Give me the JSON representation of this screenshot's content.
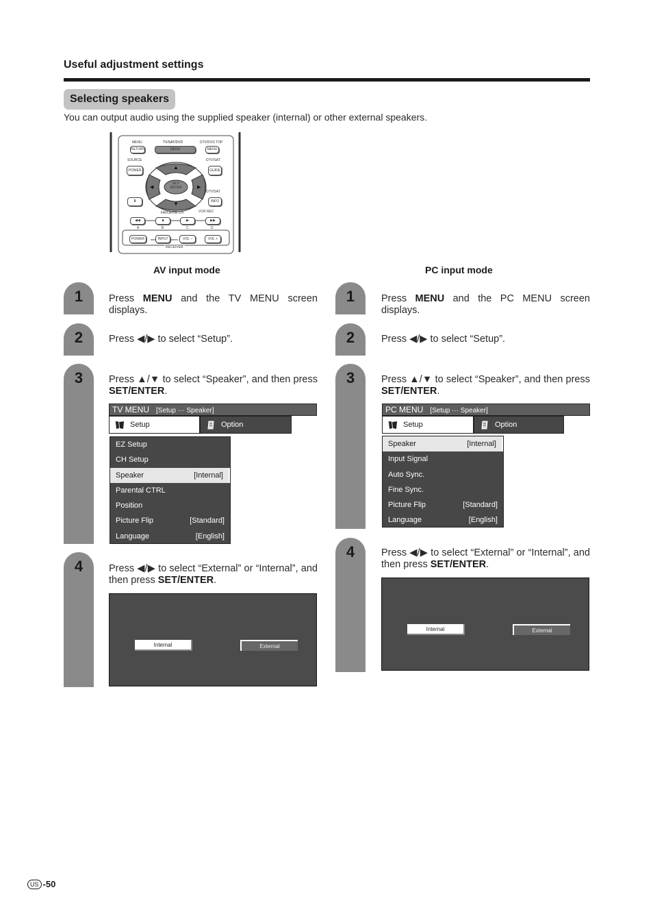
{
  "page": {
    "section_title": "Useful adjustment settings",
    "heading": "Selecting speakers",
    "intro": "You can output audio using the supplied speaker (internal) or other external speakers.",
    "page_number": "-50",
    "region_badge": "US"
  },
  "remote": {
    "labels": {
      "menu_top": "MENU",
      "tvsatdvd": "TV/SAT/DVD",
      "dtvdvd_top": "DTV/DVD TOP",
      "source": "SOURCE",
      "dtvsat1": "DTV/SAT",
      "dtvsat2": "DTV/SAT",
      "favorite": "FAVORITE CH",
      "vcr_rec": "VCR REC",
      "receiver": "RECEIVER",
      "a": "A",
      "b": "B",
      "c": "C",
      "d": "D"
    },
    "buttons": {
      "return": "RETURN",
      "menu": "MENU",
      "menu_right": "MENU",
      "power_source": "POWER",
      "guide": "GUIDE",
      "set_enter": "SET/ ENTER",
      "pause": "II",
      "info": "INFO",
      "rewind": "◀◀",
      "stop": "■",
      "play": "▶",
      "ffwd": "▶▶",
      "power_receiver": "POWER",
      "input": "INPUT",
      "vol_minus": "VOL –",
      "vol_plus": "VOL +",
      "up": "▲",
      "down": "▼",
      "left": "◀",
      "right": "▶"
    }
  },
  "av": {
    "mode_label": "AV input mode",
    "steps": [
      {
        "num": "1",
        "pre": "Press ",
        "bold": "MENU",
        "post": " and the TV MENU screen displays."
      },
      {
        "num": "2",
        "pre": "Press ◀/▶ to select “Setup”.",
        "bold": "",
        "post": ""
      },
      {
        "num": "3",
        "pre": "Press ▲/▼ to select “Speaker”, and then press ",
        "bold": "SET/ENTER",
        "post": "."
      },
      {
        "num": "4",
        "pre": "Press ◀/▶ to select “External” or “Internal”, and then press ",
        "bold": "SET/ENTER",
        "post": "."
      }
    ],
    "menu": {
      "title": "TV MENU",
      "breadcrumb": "[Setup ··· Speaker]",
      "tabs": [
        "Setup",
        "Option"
      ],
      "items": [
        {
          "label": "EZ Setup",
          "value": ""
        },
        {
          "label": "CH Setup",
          "value": ""
        },
        {
          "label": "Speaker",
          "value": "[Internal]",
          "selected": true
        },
        {
          "label": "Parental CTRL",
          "value": ""
        },
        {
          "label": "Position",
          "value": ""
        },
        {
          "label": "Picture Flip",
          "value": "[Standard]"
        },
        {
          "label": "Language",
          "value": "[English]"
        }
      ]
    },
    "choices": [
      "Internal",
      "External"
    ]
  },
  "pc": {
    "mode_label": "PC input mode",
    "steps": [
      {
        "num": "1",
        "pre": "Press ",
        "bold": "MENU",
        "post": " and the PC MENU screen displays."
      },
      {
        "num": "2",
        "pre": "Press ◀/▶ to select “Setup”.",
        "bold": "",
        "post": ""
      },
      {
        "num": "3",
        "pre": "Press ▲/▼ to select “Speaker”, and then press ",
        "bold": "SET/ENTER",
        "post": "."
      },
      {
        "num": "4",
        "pre": "Press ◀/▶ to select “External” or “Internal”, and then press ",
        "bold": "SET/ENTER",
        "post": "."
      }
    ],
    "menu": {
      "title": "PC MENU",
      "breadcrumb": "[Setup ··· Speaker]",
      "tabs": [
        "Setup",
        "Option"
      ],
      "items": [
        {
          "label": "Speaker",
          "value": "[Internal]",
          "selected": true
        },
        {
          "label": "Input Signal",
          "value": ""
        },
        {
          "label": "Auto Sync.",
          "value": ""
        },
        {
          "label": "Fine Sync.",
          "value": ""
        },
        {
          "label": "Picture Flip",
          "value": "[Standard]"
        },
        {
          "label": "Language",
          "value": "[English]"
        }
      ]
    },
    "choices": [
      "Internal",
      "External"
    ]
  }
}
